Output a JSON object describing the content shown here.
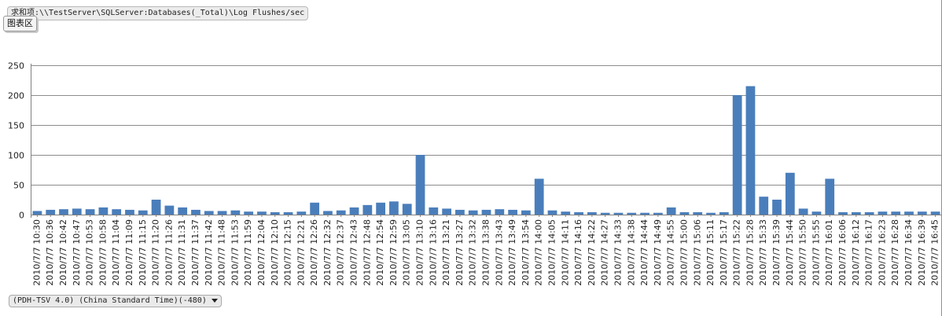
{
  "series_tag": "求和项:\\\\TestServer\\SQLServer:Databases(_Total)\\Log Flushes/sec",
  "chart_area_label": "图表区",
  "timezone_dropdown": "(PDH-TSV 4.0) (China Standard Time)(-480)",
  "colors": {
    "series": "#4a7ebb",
    "grid": "#8c8c8c",
    "axis": "#808080",
    "text": "#222222"
  },
  "icons": {
    "dropdown": "chevron-down-icon"
  },
  "chart_data": {
    "type": "bar",
    "title": "",
    "xlabel": "",
    "ylabel": "",
    "ylim": [
      0,
      250
    ],
    "yticks": [
      0,
      50,
      100,
      150,
      200,
      250
    ],
    "grid": true,
    "legend": "none",
    "x_tick_labels": [
      "2010/7/7 10:30",
      "2010/7/7 10:36",
      "2010/7/7 10:42",
      "2010/7/7 10:47",
      "2010/7/7 10:53",
      "2010/7/7 10:58",
      "2010/7/7 11:04",
      "2010/7/7 11:09",
      "2010/7/7 11:15",
      "2010/7/7 11:20",
      "2010/7/7 11:26",
      "2010/7/7 11:31",
      "2010/7/7 11:37",
      "2010/7/7 11:42",
      "2010/7/7 11:48",
      "2010/7/7 11:53",
      "2010/7/7 11:59",
      "2010/7/7 12:04",
      "2010/7/7 12:10",
      "2010/7/7 12:15",
      "2010/7/7 12:21",
      "2010/7/7 12:26",
      "2010/7/7 12:32",
      "2010/7/7 12:37",
      "2010/7/7 12:43",
      "2010/7/7 12:48",
      "2010/7/7 12:54",
      "2010/7/7 12:59",
      "2010/7/7 13:05",
      "2010/7/7 13:10",
      "2010/7/7 13:16",
      "2010/7/7 13:21",
      "2010/7/7 13:27",
      "2010/7/7 13:32",
      "2010/7/7 13:38",
      "2010/7/7 13:43",
      "2010/7/7 13:49",
      "2010/7/7 13:54",
      "2010/7/7 14:00",
      "2010/7/7 14:05",
      "2010/7/7 14:11",
      "2010/7/7 14:16",
      "2010/7/7 14:22",
      "2010/7/7 14:27",
      "2010/7/7 14:33",
      "2010/7/7 14:38",
      "2010/7/7 14:44",
      "2010/7/7 14:49",
      "2010/7/7 14:55",
      "2010/7/7 15:00",
      "2010/7/7 15:06",
      "2010/7/7 15:11",
      "2010/7/7 15:17",
      "2010/7/7 15:22",
      "2010/7/7 15:28",
      "2010/7/7 15:33",
      "2010/7/7 15:39",
      "2010/7/7 15:44",
      "2010/7/7 15:50",
      "2010/7/7 15:55",
      "2010/7/7 16:01",
      "2010/7/7 16:06",
      "2010/7/7 16:12",
      "2010/7/7 16:17",
      "2010/7/7 16:23",
      "2010/7/7 16:28",
      "2010/7/7 16:34",
      "2010/7/7 16:39",
      "2010/7/7 16:45"
    ],
    "categories": [
      "10:30",
      "10:36",
      "10:42",
      "10:47",
      "10:53",
      "10:58",
      "11:04",
      "11:09",
      "11:15",
      "11:20",
      "11:26",
      "11:31",
      "11:37",
      "11:42",
      "11:48",
      "11:53",
      "11:59",
      "12:04",
      "12:10",
      "12:15",
      "12:21",
      "12:26",
      "12:32",
      "12:37",
      "12:43",
      "12:48",
      "12:54",
      "12:59",
      "13:05",
      "13:10",
      "13:16",
      "13:21",
      "13:27",
      "13:32",
      "13:38",
      "13:43",
      "13:49",
      "13:54",
      "14:00",
      "14:05",
      "14:11",
      "14:16",
      "14:22",
      "14:27",
      "14:33",
      "14:38",
      "14:44",
      "14:49",
      "14:55",
      "15:00",
      "15:06",
      "15:11",
      "15:17",
      "15:22",
      "15:28",
      "15:33",
      "15:39",
      "15:44",
      "15:50",
      "15:55",
      "16:01",
      "16:06",
      "16:12",
      "16:17",
      "16:23",
      "16:28",
      "16:34",
      "16:39",
      "16:45"
    ],
    "series": [
      {
        "values": [
          6,
          8,
          9,
          10,
          9,
          12,
          9,
          8,
          7,
          25,
          15,
          12,
          8,
          6,
          6,
          7,
          5,
          5,
          4,
          4,
          5,
          20,
          6,
          7,
          12,
          16,
          20,
          22,
          18,
          100,
          12,
          10,
          8,
          7,
          8,
          9,
          8,
          7,
          60,
          7,
          5,
          4,
          4,
          3,
          3,
          3,
          3,
          3,
          12,
          4,
          4,
          3,
          4,
          200,
          215,
          30,
          25,
          70,
          10,
          5,
          60,
          4,
          4,
          4,
          5,
          5,
          5,
          5,
          5
        ]
      }
    ]
  }
}
